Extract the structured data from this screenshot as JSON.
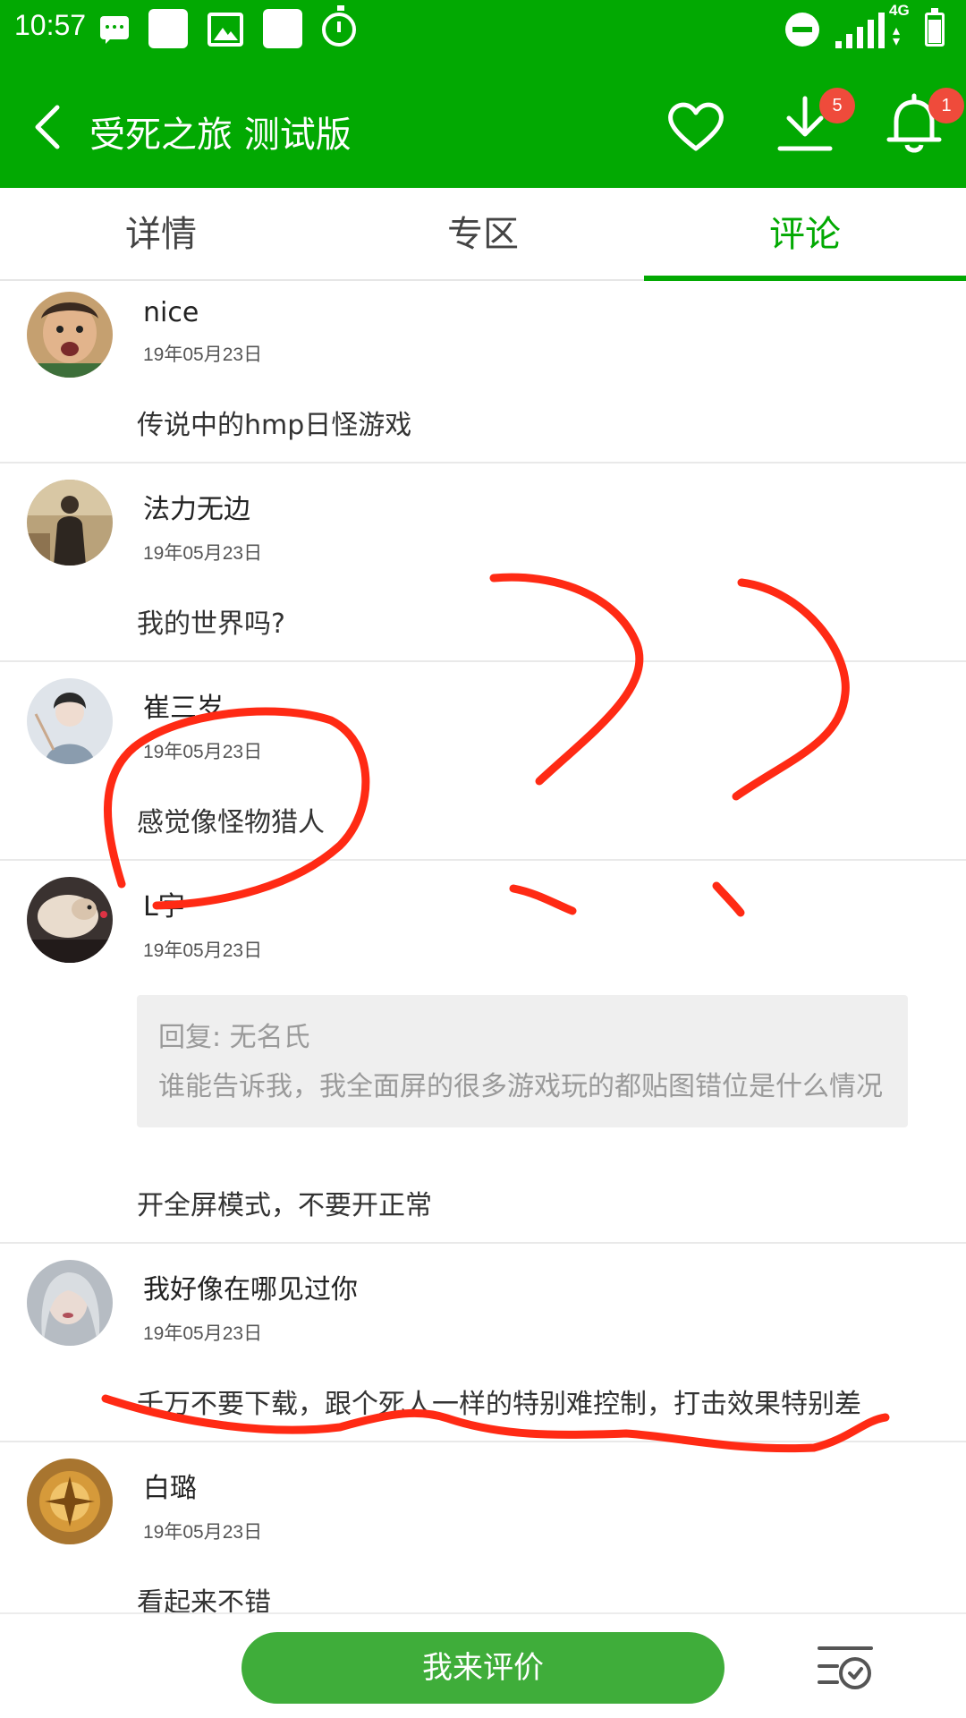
{
  "status_bar": {
    "time": "10:57",
    "network": "4G"
  },
  "app_bar": {
    "title": "受死之旅 测试版",
    "download_badge": "5",
    "notification_badge": "1"
  },
  "tabs": [
    {
      "label": "详情"
    },
    {
      "label": "专区"
    },
    {
      "label": "评论",
      "active": true
    }
  ],
  "comments": [
    {
      "user": "nice",
      "date": "19年05月23日",
      "text": "传说中的hmp日怪游戏"
    },
    {
      "user": "法力无边",
      "date": "19年05月23日",
      "text": "我的世界吗?"
    },
    {
      "user": "崔三岁",
      "date": "19年05月23日",
      "text": "感觉像怪物猎人"
    },
    {
      "user": "L字",
      "date": "19年05月23日",
      "reply_to": "回复: 无名氏",
      "reply_text": "谁能告诉我，我全面屏的很多游戏玩的都贴图错位是什么情况",
      "text": "开全屏模式，不要开正常"
    },
    {
      "user": "我好像在哪见过你",
      "date": "19年05月23日",
      "text": "千万不要下载，跟个死人一样的特别难控制，打击效果特别差"
    },
    {
      "user": "白璐",
      "date": "19年05月23日",
      "text": "看起来不错"
    }
  ],
  "bottom_bar": {
    "review_button": "我来评价"
  },
  "colors": {
    "brand_green": "#02a902",
    "button_green": "#3fad3a",
    "badge_red": "#ef4b3b",
    "annotation_red": "#ff2a14"
  }
}
